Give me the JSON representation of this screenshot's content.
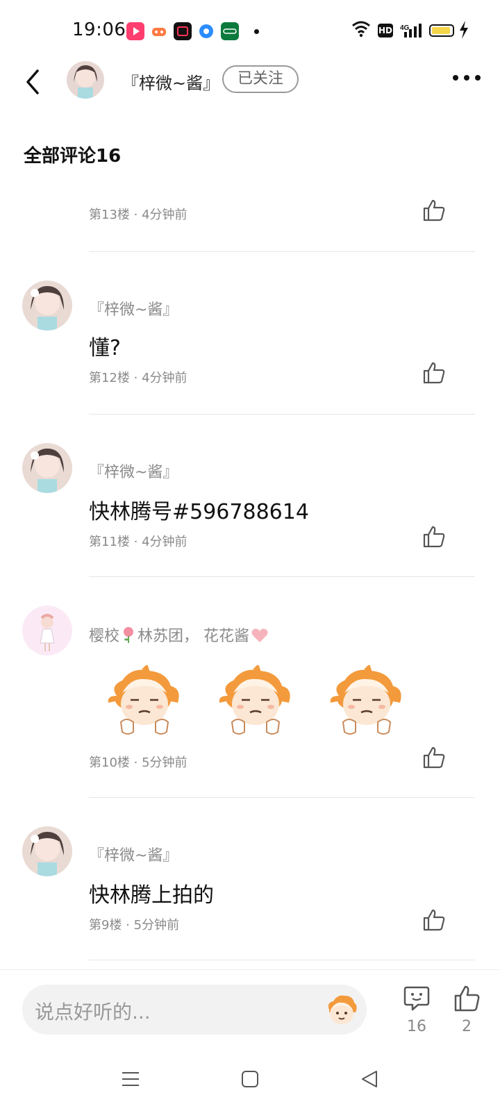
{
  "status_bar": {
    "time": "19:06",
    "network": "4G",
    "hd": "HD",
    "battery_level": 0.8,
    "notifications": [
      "video-app-icon",
      "game-app-icon",
      "recorder-app-icon",
      "browser-app-icon",
      "carrier-app-icon"
    ]
  },
  "header": {
    "username": "『梓微~酱』",
    "follow_label": "已关注"
  },
  "section": {
    "title": "全部评论16"
  },
  "comments": [
    {
      "meta": "第13楼 · 4分钟前"
    },
    {
      "name": "『梓微~酱』",
      "text": "懂?",
      "meta": "第12楼 · 4分钟前"
    },
    {
      "name": "『梓微~酱』",
      "text": "快林腾号#596788614",
      "meta": "第11楼 · 4分钟前"
    },
    {
      "name_part1": "樱校",
      "name_part2": "林苏团， 花花酱",
      "meta": "第10楼 · 5分钟前",
      "stickers": [
        "sad-sticker",
        "sad-sticker",
        "sad-sticker"
      ]
    },
    {
      "name": "『梓微~酱』",
      "text": "快林腾上拍的",
      "meta": "第9楼 · 5分钟前"
    }
  ],
  "bottom_bar": {
    "input_placeholder": "说点好听的...",
    "comment_count": "16",
    "like_count": "2"
  },
  "colors": {
    "accent_orange": "#f39a3c",
    "gray_text": "#8a8a8a",
    "divider": "#e6e6e6",
    "input_bg": "#f2f2f2"
  }
}
